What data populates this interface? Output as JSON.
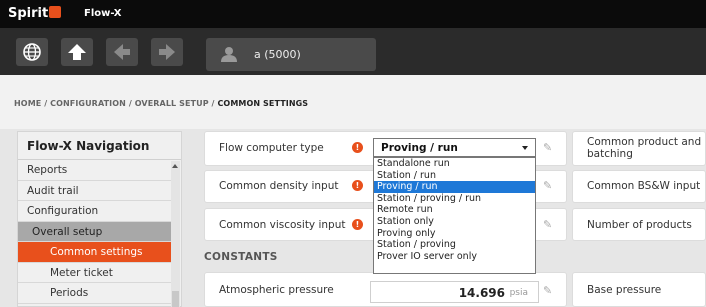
{
  "app": {
    "brand": "Spirit",
    "product": "Flow-X"
  },
  "user": {
    "name": "a (5000)"
  },
  "toolbar": {
    "icons": [
      "globe-icon",
      "home-arrow-up-icon",
      "back-arrow-icon",
      "forward-arrow-icon"
    ]
  },
  "breadcrumb": {
    "path": "HOME / CONFIGURATION / OVERALL SETUP / ",
    "current": "COMMON SETTINGS"
  },
  "sidebar": {
    "title": "Flow-X Navigation",
    "items": [
      "Reports",
      "Audit trail",
      "Configuration",
      "Overall setup",
      "Common settings",
      "Meter ticket",
      "Periods"
    ]
  },
  "form": {
    "flow_computer_type": {
      "label": "Flow computer type",
      "value": "Proving / run"
    },
    "common_density_input": {
      "label": "Common density input"
    },
    "common_viscosity_input": {
      "label": "Common viscosity input"
    },
    "common_product_batching": {
      "label": "Common product and batching"
    },
    "common_bsw_input": {
      "label": "Common BS&W input"
    },
    "number_of_products": {
      "label": "Number of products"
    },
    "constants_title": "CONSTANTS",
    "atmospheric_pressure": {
      "label": "Atmospheric pressure",
      "value": "14.696",
      "unit": "psia"
    },
    "base_pressure": {
      "label": "Base pressure"
    }
  },
  "dropdown": {
    "options": [
      "Standalone run",
      "Station / run",
      "Proving / run",
      "Station / proving / run",
      "Remote run",
      "Station only",
      "Proving only",
      "Station / proving",
      "Prover IO server only"
    ],
    "selected_index": 2
  },
  "colors": {
    "accent": "#e8501c",
    "selection": "#1e78d7",
    "topbar": "#0b0b0b",
    "toolbar": "#2b2b2b"
  }
}
